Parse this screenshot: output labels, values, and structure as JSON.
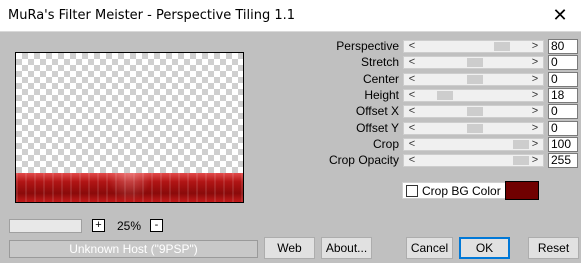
{
  "window": {
    "title": "MuRa's Filter Meister - Perspective Tiling 1.1",
    "close_glyph": "✕"
  },
  "zoom": {
    "minus": "-",
    "plus": "+",
    "value": "25%"
  },
  "status_text": "Unknown Host (\"9PSP\")",
  "params": [
    {
      "label": "Perspective",
      "value": "80",
      "level": 0.8
    },
    {
      "label": "Stretch",
      "value": "0",
      "level": 0.5
    },
    {
      "label": "Center",
      "value": "0",
      "level": 0.5
    },
    {
      "label": "Height",
      "value": "18",
      "level": 0.18
    },
    {
      "label": "Offset X",
      "value": "0",
      "level": 0.5
    },
    {
      "label": "Offset Y",
      "value": "0",
      "level": 0.5
    },
    {
      "label": "Crop",
      "value": "100",
      "level": 1.0
    },
    {
      "label": "Crop Opacity",
      "value": "255",
      "level": 1.0
    }
  ],
  "crop_bg": {
    "label": "Crop BG Color",
    "checked": false,
    "color": "#700000"
  },
  "buttons": {
    "web": "Web",
    "about": "About...",
    "cancel": "Cancel",
    "ok": "OK",
    "reset": "Reset"
  },
  "arrows": {
    "left": "<",
    "right": ">"
  }
}
